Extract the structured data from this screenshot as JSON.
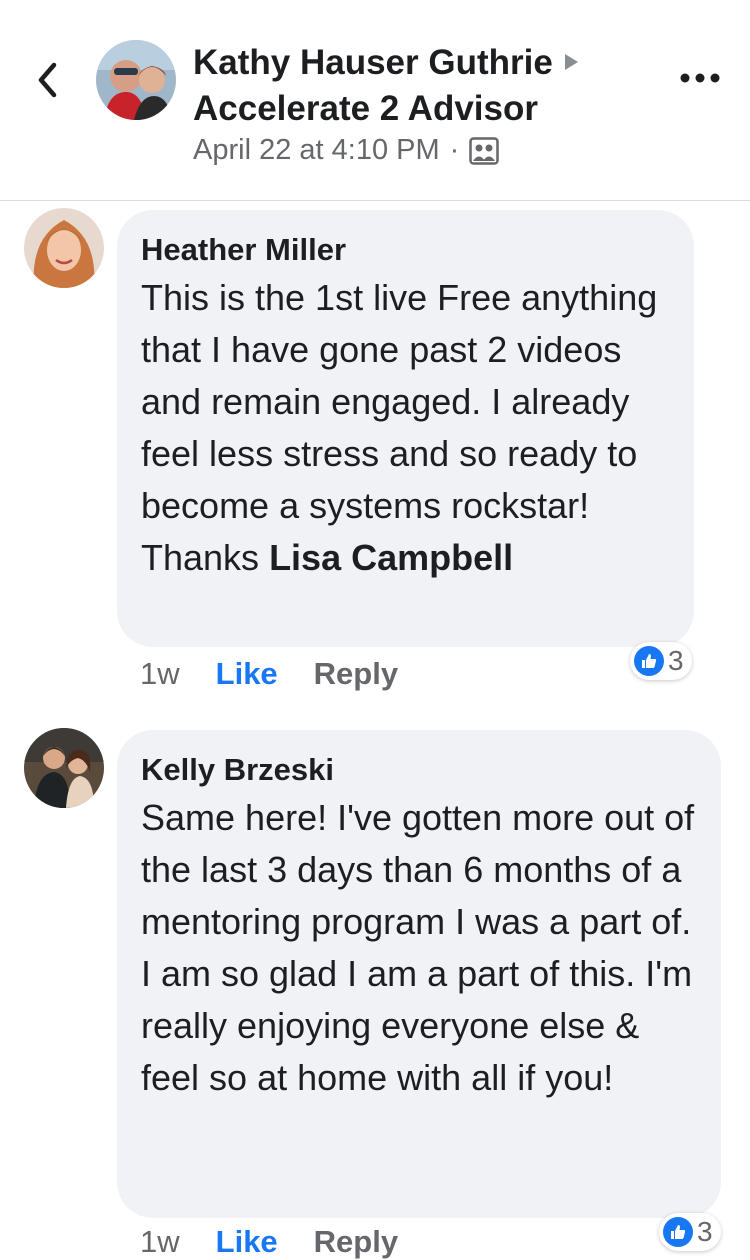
{
  "header": {
    "back_icon": "chevron-left-icon",
    "title_line1": "Kathy Hauser Guthrie",
    "title_line2": "Accelerate 2 Advisor",
    "timestamp": "April 22 at 4:10 PM",
    "separator": "·",
    "audience_icon": "group-icon",
    "more_icon": "more-horizontal-icon"
  },
  "comments": [
    {
      "author": "Heather Miller",
      "text": "This is the 1st live Free anything that I have gone past 2 videos and remain engaged. I already feel less stress and so ready to become a systems rockstar! Thanks ",
      "mention": "Lisa Campbell",
      "time": "1w",
      "like_label": "Like",
      "reply_label": "Reply",
      "reaction_count": "3"
    },
    {
      "author": "Kelly Brzeski",
      "text": "Same here!  I've gotten more out of the last 3 days than 6 months of a mentoring program I was a part of.  I am so glad I am a part of this.  I'm really enjoying everyone else & feel so at home with all if you!",
      "time": "1w",
      "like_label": "Like",
      "reply_label": "Reply",
      "reaction_count": "3"
    }
  ],
  "colors": {
    "accent": "#1877f2",
    "bubble": "#f0f2f5",
    "muted": "#65676b"
  }
}
